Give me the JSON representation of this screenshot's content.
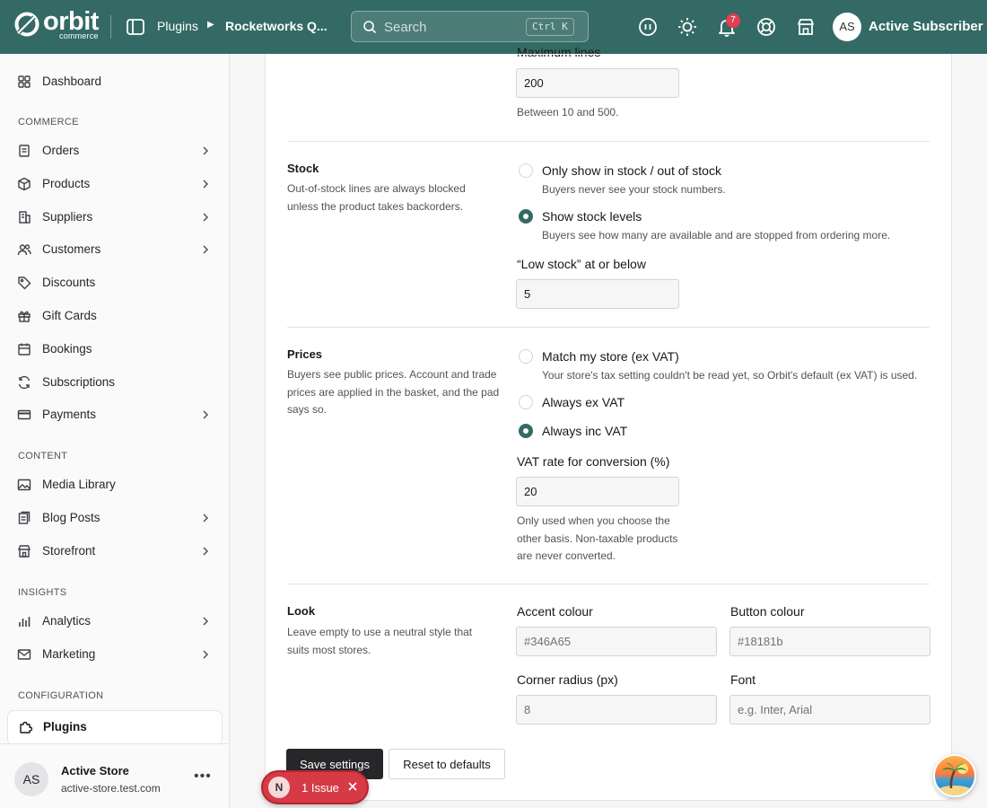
{
  "header": {
    "logo_word": "orbit",
    "logo_sub": "commerce",
    "breadcrumb": [
      "Plugins",
      "Rocketworks Q..."
    ],
    "search_placeholder": "Search",
    "search_shortcut": "Ctrl K",
    "notifications_count": "7",
    "user_initials": "AS",
    "user_name": "Active Subscriber",
    "icons": [
      "sidebar-toggle-icon",
      "chat-icon",
      "sun-icon",
      "bell-icon",
      "help-buoy-icon",
      "store-icon"
    ]
  },
  "sidebar": {
    "dashboard": "Dashboard",
    "sections": {
      "commerce": "COMMERCE",
      "content": "CONTENT",
      "insights": "INSIGHTS",
      "configuration": "CONFIGURATION"
    },
    "items": {
      "orders": "Orders",
      "products": "Products",
      "suppliers": "Suppliers",
      "customers": "Customers",
      "discounts": "Discounts",
      "gift_cards": "Gift Cards",
      "bookings": "Bookings",
      "subscriptions": "Subscriptions",
      "payments": "Payments",
      "media_library": "Media Library",
      "blog_posts": "Blog Posts",
      "storefront": "Storefront",
      "analytics": "Analytics",
      "marketing": "Marketing",
      "plugins": "Plugins"
    },
    "store": {
      "initials": "AS",
      "name": "Active Store",
      "url": "active-store.test.com",
      "menu": "..."
    }
  },
  "settings": {
    "max_lines": {
      "label": "Maximum lines",
      "value": "200",
      "help": "Between 10 and 500."
    },
    "stock": {
      "title": "Stock",
      "description": "Out-of-stock lines are always blocked unless the product takes backorders.",
      "options": [
        {
          "label": "Only show in stock / out of stock",
          "help": "Buyers never see your stock numbers.",
          "checked": false
        },
        {
          "label": "Show stock levels",
          "help": "Buyers see how many are available and are stopped from ordering more.",
          "checked": true
        }
      ],
      "low_stock_label": "“Low stock” at or below",
      "low_stock_value": "5"
    },
    "prices": {
      "title": "Prices",
      "description": "Buyers see public prices. Account and trade prices are applied in the basket, and the pad says so.",
      "options": [
        {
          "label": "Match my store (ex VAT)",
          "help": "Your store's tax setting couldn't be read yet, so Orbit's default (ex VAT) is used.",
          "checked": false
        },
        {
          "label": "Always ex VAT",
          "help": "",
          "checked": false
        },
        {
          "label": "Always inc VAT",
          "help": "",
          "checked": true
        }
      ],
      "vat_label": "VAT rate for conversion (%)",
      "vat_value": "20",
      "vat_help": "Only used when you choose the other basis. Non-taxable products are never converted."
    },
    "look": {
      "title": "Look",
      "description": "Leave empty to use a neutral style that suits most stores.",
      "accent_label": "Accent colour",
      "accent_placeholder": "#346A65",
      "button_label": "Button colour",
      "button_placeholder": "#18181b",
      "radius_label": "Corner radius (px)",
      "radius_placeholder": "8",
      "font_label": "Font",
      "font_placeholder": "e.g. Inter, Arial"
    },
    "save_label": "Save settings",
    "reset_label": "Reset to defaults"
  },
  "issue_pill": {
    "badge": "N",
    "text": "1 Issue"
  },
  "colors": {
    "brand": "#346a65",
    "primary_button": "#27272a",
    "issue": "#d63a45",
    "badge": "#e23f50"
  }
}
